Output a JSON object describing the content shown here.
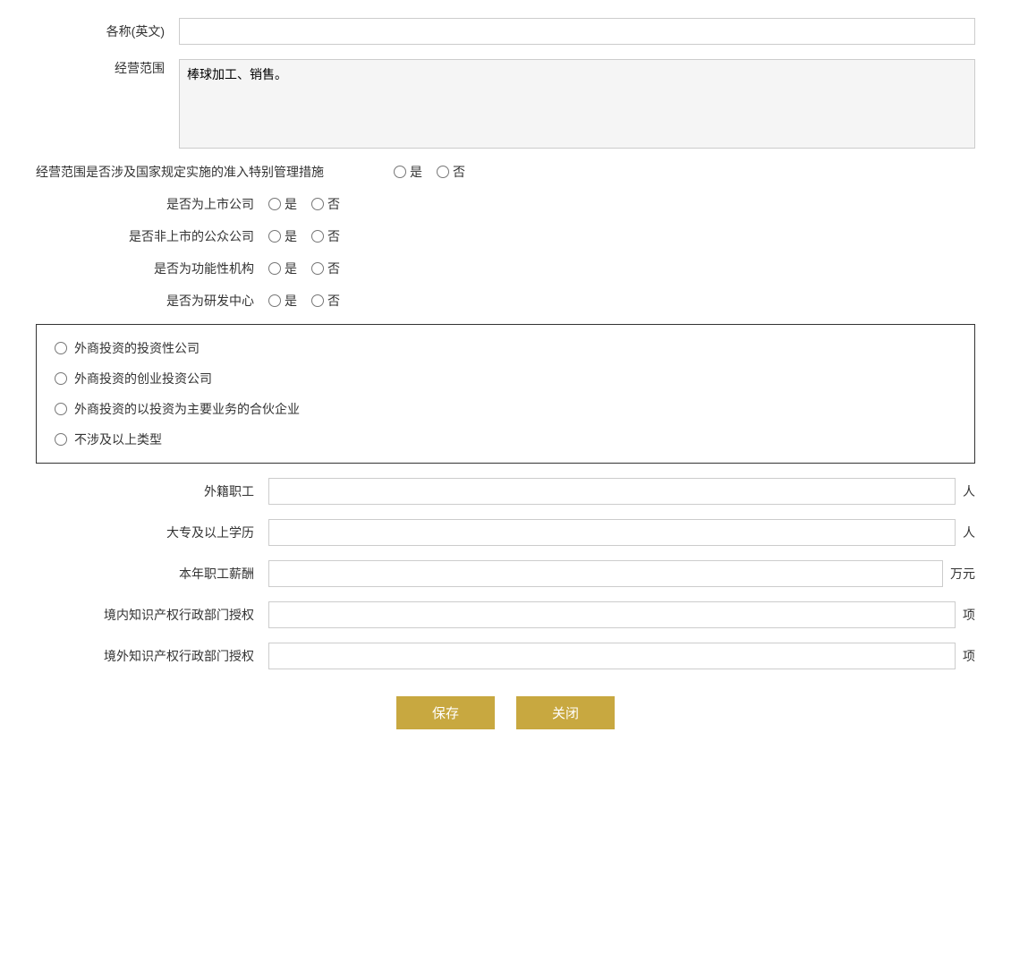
{
  "form": {
    "fields": {
      "name_en_label": "各称(英文)",
      "business_scope_label": "经营范围",
      "business_scope_value": "棒球加工、销售。",
      "special_management_label": "经营范围是否涉及国家规定实施的准入特别管理措施",
      "listed_company_label": "是否为上市公司",
      "public_company_label": "是否非上市的公众公司",
      "functional_org_label": "是否为功能性机构",
      "rd_center_label": "是否为研发中心",
      "foreign_workers_label": "外籍职工",
      "foreign_workers_unit": "人",
      "college_degree_label": "大专及以上学历",
      "college_degree_unit": "人",
      "annual_salary_label": "本年职工薪酬",
      "annual_salary_unit": "万元",
      "domestic_ip_label": "境内知识产权行政部门授权",
      "domestic_ip_unit": "项",
      "foreign_ip_label": "境外知识产权行政部门授权",
      "foreign_ip_unit": "项"
    },
    "radio_yes": "是",
    "radio_no": "否",
    "investment_types": [
      "外商投资的投资性公司",
      "外商投资的创业投资公司",
      "外商投资的以投资为主要业务的合伙企业",
      "不涉及以上类型"
    ],
    "buttons": {
      "save": "保存",
      "close": "关闭"
    }
  }
}
